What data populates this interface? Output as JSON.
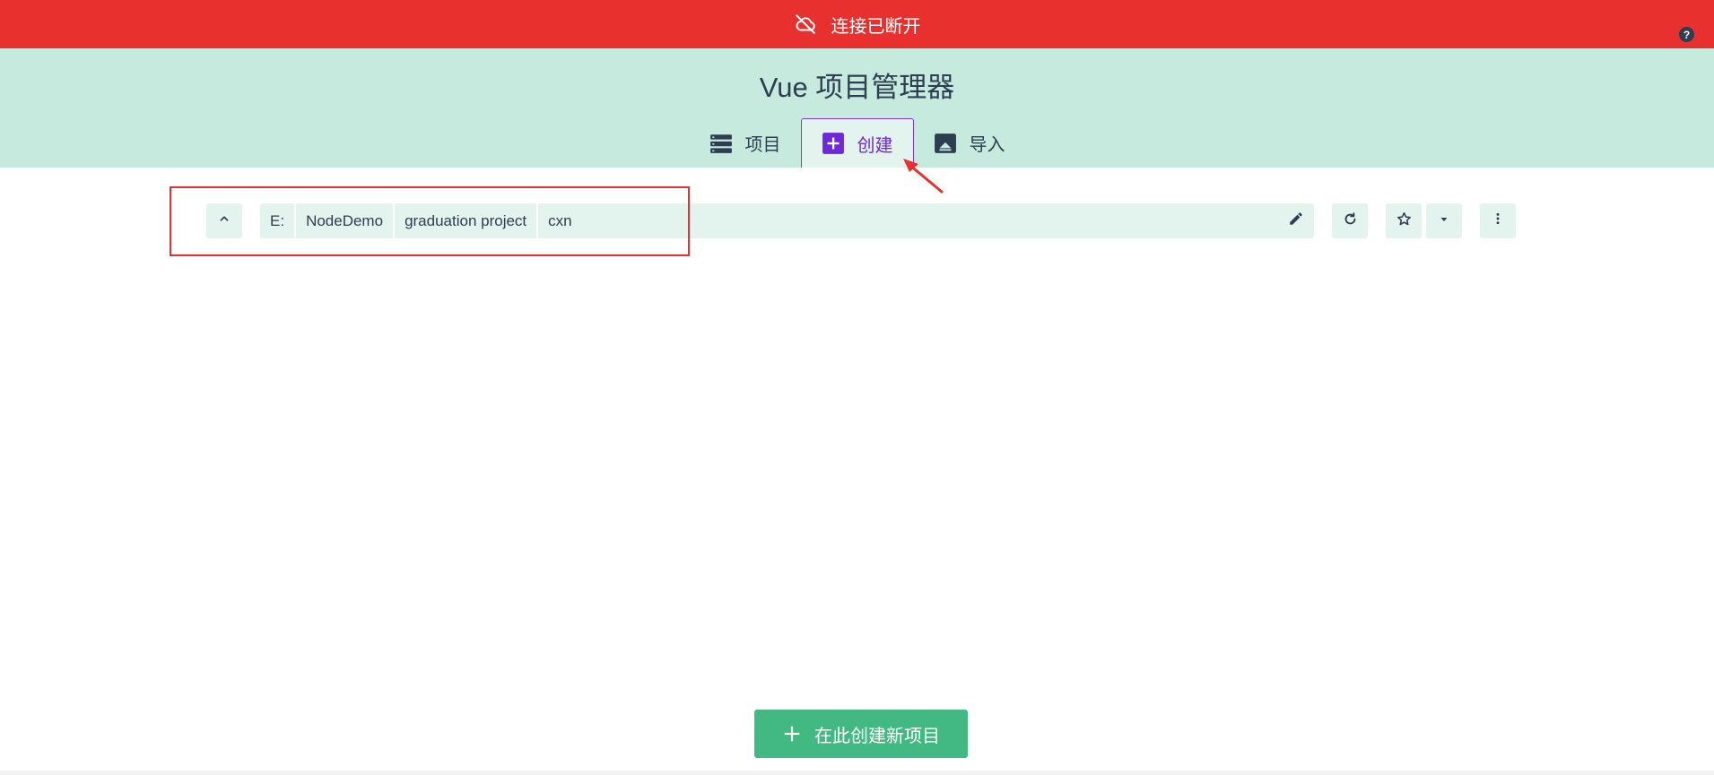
{
  "banner": {
    "text": "连接已断开",
    "icon": "cloud-off-icon",
    "color": "#e8302f"
  },
  "help": {
    "label": "?"
  },
  "header": {
    "title": "Vue 项目管理器",
    "background": "#c7eadf"
  },
  "tabs": [
    {
      "label": "项目",
      "icon": "list-icon",
      "active": false
    },
    {
      "label": "创建",
      "icon": "plus-box-icon",
      "active": true
    },
    {
      "label": "导入",
      "icon": "import-icon",
      "active": false
    }
  ],
  "path": {
    "segments": [
      "E:",
      "NodeDemo",
      "graduation project",
      "cxn"
    ],
    "actions": [
      "edit-icon",
      "refresh-icon",
      "star-icon",
      "dropdown-icon",
      "more-icon"
    ]
  },
  "create": {
    "label": "在此创建新项目",
    "color": "#42b983"
  }
}
